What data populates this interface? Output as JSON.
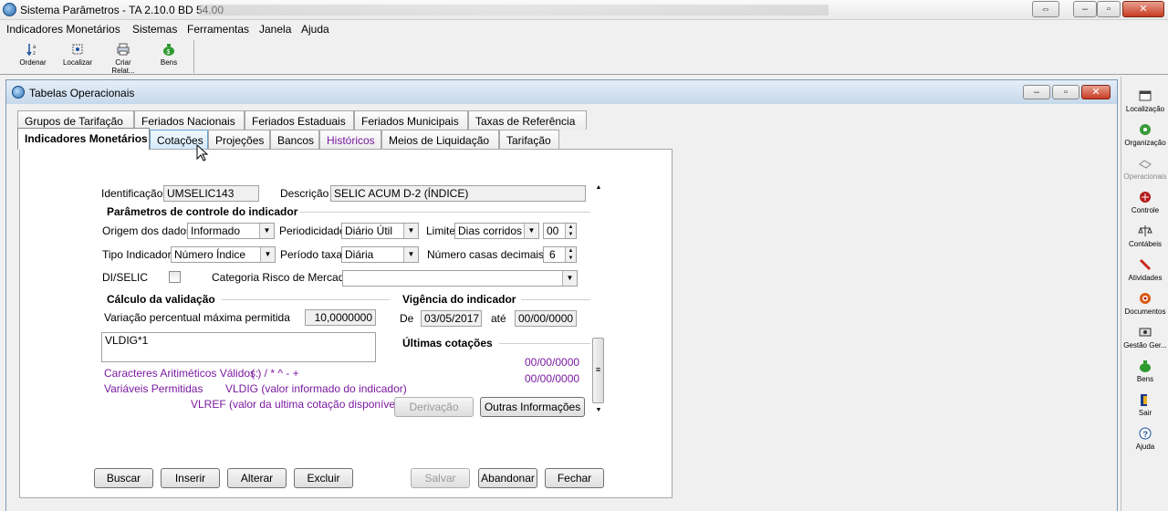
{
  "app": {
    "title": "Sistema Parâmetros -  TA 2.10.0 BD 54.00"
  },
  "menu": [
    "Indicadores Monetários",
    "Sistemas",
    "Ferramentas",
    "Janela",
    "Ajuda"
  ],
  "toolbar": {
    "ordenar": "Ordenar",
    "localizar": "Localizar",
    "criar_relatorio": "Criar Relat...",
    "bens": "Bens"
  },
  "right_panel": {
    "localizacao": "Localização",
    "organizacao": "Organização",
    "operacionais": "Operacionais",
    "controle": "Controle",
    "contabeis": "Contábeis",
    "atividades": "Atividades",
    "documentos": "Documentos",
    "gestao": "Gestão Ger...",
    "bens": "Bens",
    "sair": "Sair",
    "ajuda": "Ajuda"
  },
  "window": {
    "title": "Tabelas Operacionais"
  },
  "tabs_row1": [
    "Grupos de Tarifação",
    "Feriados Nacionais",
    "Feriados Estaduais",
    "Feriados Municipais",
    "Taxas de Referência"
  ],
  "tabs_row2": [
    "Indicadores Monetários",
    "Cotações",
    "Projeções",
    "Bancos",
    "Históricos",
    "Meios de Liquidação",
    "Tarifação"
  ],
  "form": {
    "identificacao_label": "Identificação",
    "identificacao_value": "UMSELIC143",
    "descricao_label": "Descrição",
    "descricao_value": "SELIC ACUM D-2 (ÍNDICE)",
    "params_title": "Parâmetros de controle do indicador",
    "origem_label": "Origem dos dados",
    "origem_value": "Informado",
    "periodicidade_label": "Periodicidade",
    "periodicidade_value": "Diário Útil",
    "limite_label": "Limite",
    "limite_value": "Dias corridos",
    "limite_num": "00",
    "tipo_label": "Tipo Indicador",
    "tipo_value": "Número Índice",
    "periodo_label": "Período taxa",
    "periodo_value": "Diária",
    "casas_label": "Número casas decimais",
    "casas_value": "6",
    "diselic_label": "DI/SELIC",
    "categoria_label": "Categoria Risco de Mercado",
    "categoria_value": "",
    "calculo_title": "Cálculo da validação",
    "variacao_label": "Variação percentual máxima permitida",
    "variacao_value": "10,0000000",
    "formula_value": "VLDIG*1",
    "caracteres_label": "Caracteres Aritiméticos Válidos:",
    "caracteres_value": "( ) / * ^ - +",
    "variaveis_label": "Variáveis Permitidas",
    "vldig_text": "VLDIG  (valor informado do indicador)",
    "vlref_text": "VLREF (valor da ultima cotação disponível)",
    "vigencia_title": "Vigência do indicador",
    "de_label": "De",
    "de_value": "03/05/2017",
    "ate_label": "até",
    "ate_value": "00/00/0000",
    "ultimas_title": "Últimas cotações",
    "ultima1": "00/00/0000",
    "ultima2": "00/00/0000",
    "derivacao_button": "Derivação",
    "outras_button": "Outras Informações"
  },
  "buttons": {
    "buscar": "Buscar",
    "inserir": "Inserir",
    "alterar": "Alterar",
    "excluir": "Excluir",
    "salvar": "Salvar",
    "abandonar": "Abandonar",
    "fechar": "Fechar"
  },
  "colors": {
    "accent_purple": "#7a1a9e",
    "window_border": "#7a99b8"
  }
}
